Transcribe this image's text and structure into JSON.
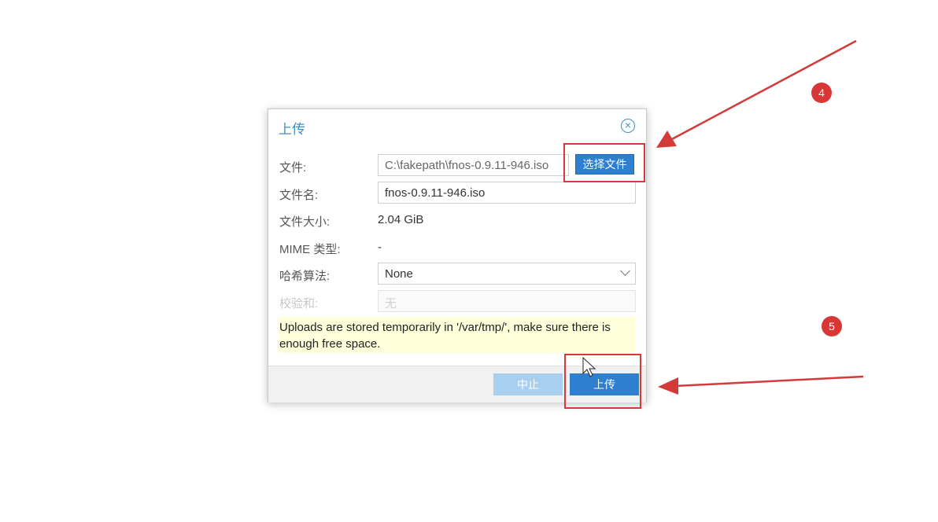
{
  "dialog": {
    "title": "上传",
    "fields": {
      "file_label": "文件:",
      "file_path": "C:\\fakepath\\fnos-0.9.11-946.iso",
      "choose_button": "选择文件",
      "filename_label": "文件名:",
      "filename_value": "fnos-0.9.11-946.iso",
      "filesize_label": "文件大小:",
      "filesize_value": "2.04 GiB",
      "mime_label": "MIME 类型:",
      "mime_value": "-",
      "hash_label": "哈希算法:",
      "hash_value": "None",
      "checksum_label": "校验和:",
      "checksum_placeholder": "无"
    },
    "notice": "Uploads are stored temporarily in '/var/tmp/', make sure there is enough free space.",
    "buttons": {
      "stop": "中止",
      "upload": "上传"
    }
  },
  "annotations": {
    "step4": "4",
    "step5": "5"
  },
  "colors": {
    "accent": "#2e7fd0",
    "annotation_red": "#d33a3a",
    "notice_bg": "#ffffdc"
  },
  "icons": {
    "close": "circle-x-icon",
    "dropdown": "chevron-down-icon",
    "cursor": "mouse-pointer-icon"
  }
}
